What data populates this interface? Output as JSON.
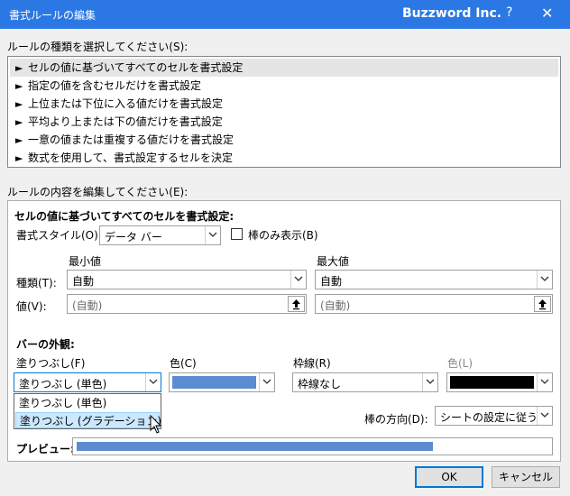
{
  "window": {
    "title": "書式ルールの編集",
    "brand": "Buzzword Inc.",
    "help_label": "?",
    "close_label": "✕"
  },
  "rule_type": {
    "label": "ルールの種類を選択してください(S):",
    "items": [
      {
        "label": "セルの値に基づいてすべてのセルを書式設定",
        "selected": true
      },
      {
        "label": "指定の値を含むセルだけを書式設定",
        "selected": false
      },
      {
        "label": "上位または下位に入る値だけを書式設定",
        "selected": false
      },
      {
        "label": "平均より上または下の値だけを書式設定",
        "selected": false
      },
      {
        "label": "一意の値または重複する値だけを書式設定",
        "selected": false
      },
      {
        "label": "数式を使用して、書式設定するセルを決定",
        "selected": false
      }
    ],
    "arrow_glyph": "►"
  },
  "edit_section": {
    "label": "ルールの内容を編集してください(E):",
    "heading": "セルの値に基づいてすべてのセルを書式設定:",
    "format_style_label": "書式スタイル(O):",
    "format_style_value": "データ バー",
    "bar_only_label": "棒のみ表示(B)",
    "bar_only_checked": false,
    "min_label": "最小値",
    "max_label": "最大値",
    "type_label": "種類(T):",
    "value_label": "値(V):",
    "min_type": "自動",
    "max_type": "自動",
    "min_value_placeholder": "(自動)",
    "max_value_placeholder": "(自動)",
    "bar_appearance_heading": "バーの外観:",
    "fill_label": "塗りつぶし(F)",
    "fill_color_label": "色(C)",
    "border_label": "枠線(R)",
    "border_color_label": "色(L)",
    "fill_value": "塗りつぶし (単色)",
    "fill_color": "#5b8bd0",
    "border_value": "枠線なし",
    "border_color": "#000000",
    "fill_options": [
      "塗りつぶし (単色)",
      "塗りつぶし (グラデーション)"
    ],
    "direction_label": "棒の方向(D):",
    "direction_value": "シートの設定に従う",
    "preview_label": "プレビュー:",
    "preview_bar_color": "#5b8bd0"
  },
  "buttons": {
    "ok": "OK",
    "cancel": "キャンセル"
  }
}
